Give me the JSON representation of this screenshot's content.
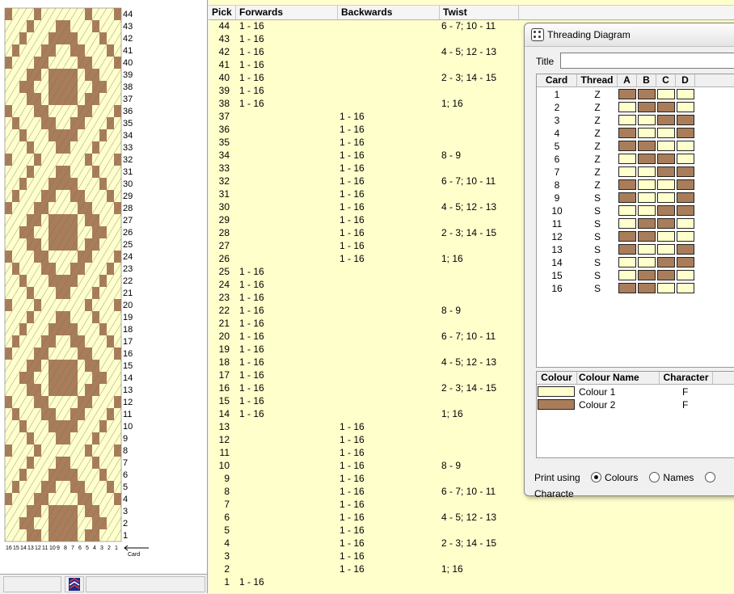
{
  "colors": {
    "brown": "#a97d5a",
    "cream": "#ffffcc"
  },
  "pattern": {
    "row_labels": [
      "44",
      "43",
      "42",
      "41",
      "40",
      "39",
      "38",
      "37",
      "36",
      "35",
      "34",
      "33",
      "32",
      "31",
      "30",
      "29",
      "28",
      "27",
      "26",
      "25",
      "24",
      "23",
      "22",
      "21",
      "20",
      "19",
      "18",
      "17",
      "16",
      "15",
      "14",
      "13",
      "12",
      "11",
      "10",
      "9",
      "8",
      "7",
      "6",
      "5",
      "4",
      "3",
      "2",
      "1"
    ],
    "card_label": "Card",
    "card_numbers": [
      "16",
      "15",
      "14",
      "13",
      "12",
      "11",
      "10",
      "9",
      "8",
      "7",
      "6",
      "5",
      "4",
      "3",
      "2",
      "1"
    ]
  },
  "table": {
    "headers": {
      "pick": "Pick",
      "forwards": "Forwards",
      "backwards": "Backwards",
      "twist": "Twist"
    },
    "rows": [
      {
        "pick": "44",
        "fwd": "1 - 16",
        "bwd": "",
        "twist": "6 - 7; 10 - 11"
      },
      {
        "pick": "43",
        "fwd": "1 - 16",
        "bwd": "",
        "twist": ""
      },
      {
        "pick": "42",
        "fwd": "1 - 16",
        "bwd": "",
        "twist": "4 - 5; 12 - 13"
      },
      {
        "pick": "41",
        "fwd": "1 - 16",
        "bwd": "",
        "twist": ""
      },
      {
        "pick": "40",
        "fwd": "1 - 16",
        "bwd": "",
        "twist": "2 - 3; 14 - 15"
      },
      {
        "pick": "39",
        "fwd": "1 - 16",
        "bwd": "",
        "twist": ""
      },
      {
        "pick": "38",
        "fwd": "1 - 16",
        "bwd": "",
        "twist": "1; 16"
      },
      {
        "pick": "37",
        "fwd": "",
        "bwd": "1 - 16",
        "twist": ""
      },
      {
        "pick": "36",
        "fwd": "",
        "bwd": "1 - 16",
        "twist": ""
      },
      {
        "pick": "35",
        "fwd": "",
        "bwd": "1 - 16",
        "twist": ""
      },
      {
        "pick": "34",
        "fwd": "",
        "bwd": "1 - 16",
        "twist": "8 - 9"
      },
      {
        "pick": "33",
        "fwd": "",
        "bwd": "1 - 16",
        "twist": ""
      },
      {
        "pick": "32",
        "fwd": "",
        "bwd": "1 - 16",
        "twist": "6 - 7; 10 - 11"
      },
      {
        "pick": "31",
        "fwd": "",
        "bwd": "1 - 16",
        "twist": ""
      },
      {
        "pick": "30",
        "fwd": "",
        "bwd": "1 - 16",
        "twist": "4 - 5; 12 - 13"
      },
      {
        "pick": "29",
        "fwd": "",
        "bwd": "1 - 16",
        "twist": ""
      },
      {
        "pick": "28",
        "fwd": "",
        "bwd": "1 - 16",
        "twist": "2 - 3; 14 - 15"
      },
      {
        "pick": "27",
        "fwd": "",
        "bwd": "1 - 16",
        "twist": ""
      },
      {
        "pick": "26",
        "fwd": "",
        "bwd": "1 - 16",
        "twist": "1; 16"
      },
      {
        "pick": "25",
        "fwd": "1 - 16",
        "bwd": "",
        "twist": ""
      },
      {
        "pick": "24",
        "fwd": "1 - 16",
        "bwd": "",
        "twist": ""
      },
      {
        "pick": "23",
        "fwd": "1 - 16",
        "bwd": "",
        "twist": ""
      },
      {
        "pick": "22",
        "fwd": "1 - 16",
        "bwd": "",
        "twist": "8 - 9"
      },
      {
        "pick": "21",
        "fwd": "1 - 16",
        "bwd": "",
        "twist": ""
      },
      {
        "pick": "20",
        "fwd": "1 - 16",
        "bwd": "",
        "twist": "6 - 7; 10 - 11"
      },
      {
        "pick": "19",
        "fwd": "1 - 16",
        "bwd": "",
        "twist": ""
      },
      {
        "pick": "18",
        "fwd": "1 - 16",
        "bwd": "",
        "twist": "4 - 5; 12 - 13"
      },
      {
        "pick": "17",
        "fwd": "1 - 16",
        "bwd": "",
        "twist": ""
      },
      {
        "pick": "16",
        "fwd": "1 - 16",
        "bwd": "",
        "twist": "2 - 3; 14 - 15"
      },
      {
        "pick": "15",
        "fwd": "1 - 16",
        "bwd": "",
        "twist": ""
      },
      {
        "pick": "14",
        "fwd": "1 - 16",
        "bwd": "",
        "twist": "1; 16"
      },
      {
        "pick": "13",
        "fwd": "",
        "bwd": "1 - 16",
        "twist": ""
      },
      {
        "pick": "12",
        "fwd": "",
        "bwd": "1 - 16",
        "twist": ""
      },
      {
        "pick": "11",
        "fwd": "",
        "bwd": "1 - 16",
        "twist": ""
      },
      {
        "pick": "10",
        "fwd": "",
        "bwd": "1 - 16",
        "twist": "8 - 9"
      },
      {
        "pick": "9",
        "fwd": "",
        "bwd": "1 - 16",
        "twist": ""
      },
      {
        "pick": "8",
        "fwd": "",
        "bwd": "1 - 16",
        "twist": "6 - 7; 10 - 11"
      },
      {
        "pick": "7",
        "fwd": "",
        "bwd": "1 - 16",
        "twist": ""
      },
      {
        "pick": "6",
        "fwd": "",
        "bwd": "1 - 16",
        "twist": "4 - 5; 12 - 13"
      },
      {
        "pick": "5",
        "fwd": "",
        "bwd": "1 - 16",
        "twist": ""
      },
      {
        "pick": "4",
        "fwd": "",
        "bwd": "1 - 16",
        "twist": "2 - 3; 14 - 15"
      },
      {
        "pick": "3",
        "fwd": "",
        "bwd": "1 - 16",
        "twist": ""
      },
      {
        "pick": "2",
        "fwd": "",
        "bwd": "1 - 16",
        "twist": "1; 16"
      },
      {
        "pick": "1",
        "fwd": "1 - 16",
        "bwd": "",
        "twist": ""
      }
    ]
  },
  "dialog": {
    "title": "Threading Diagram",
    "title_label": "Title",
    "title_value": "",
    "card_headers": {
      "card": "Card",
      "thread": "Thread",
      "a": "A",
      "b": "B",
      "c": "C",
      "d": "D"
    },
    "cards": [
      {
        "num": "1",
        "dir": "Z",
        "holes": [
          "brown",
          "brown",
          "cream",
          "cream"
        ]
      },
      {
        "num": "2",
        "dir": "Z",
        "holes": [
          "cream",
          "brown",
          "brown",
          "cream"
        ]
      },
      {
        "num": "3",
        "dir": "Z",
        "holes": [
          "cream",
          "cream",
          "brown",
          "brown"
        ]
      },
      {
        "num": "4",
        "dir": "Z",
        "holes": [
          "brown",
          "cream",
          "cream",
          "brown"
        ]
      },
      {
        "num": "5",
        "dir": "Z",
        "holes": [
          "brown",
          "brown",
          "cream",
          "cream"
        ]
      },
      {
        "num": "6",
        "dir": "Z",
        "holes": [
          "cream",
          "brown",
          "brown",
          "cream"
        ]
      },
      {
        "num": "7",
        "dir": "Z",
        "holes": [
          "cream",
          "cream",
          "brown",
          "brown"
        ]
      },
      {
        "num": "8",
        "dir": "Z",
        "holes": [
          "brown",
          "cream",
          "cream",
          "brown"
        ]
      },
      {
        "num": "9",
        "dir": "S",
        "holes": [
          "brown",
          "cream",
          "cream",
          "brown"
        ]
      },
      {
        "num": "10",
        "dir": "S",
        "holes": [
          "cream",
          "cream",
          "brown",
          "brown"
        ]
      },
      {
        "num": "11",
        "dir": "S",
        "holes": [
          "cream",
          "brown",
          "brown",
          "cream"
        ]
      },
      {
        "num": "12",
        "dir": "S",
        "holes": [
          "brown",
          "brown",
          "cream",
          "cream"
        ]
      },
      {
        "num": "13",
        "dir": "S",
        "holes": [
          "brown",
          "cream",
          "cream",
          "brown"
        ]
      },
      {
        "num": "14",
        "dir": "S",
        "holes": [
          "cream",
          "cream",
          "brown",
          "brown"
        ]
      },
      {
        "num": "15",
        "dir": "S",
        "holes": [
          "cream",
          "brown",
          "brown",
          "cream"
        ]
      },
      {
        "num": "16",
        "dir": "S",
        "holes": [
          "brown",
          "brown",
          "cream",
          "cream"
        ]
      }
    ],
    "colour_headers": {
      "colour": "Colour",
      "name": "Colour Name",
      "character": "Character"
    },
    "colours": [
      {
        "swatch": "cream",
        "name": "Colour 1",
        "char": "F"
      },
      {
        "swatch": "brown",
        "name": "Colour 2",
        "char": "F"
      }
    ],
    "print_label": "Print using",
    "print_options": [
      {
        "label": "Colours",
        "selected": true
      },
      {
        "label": "Names",
        "selected": false
      },
      {
        "label": "Characte",
        "selected": false
      }
    ]
  }
}
